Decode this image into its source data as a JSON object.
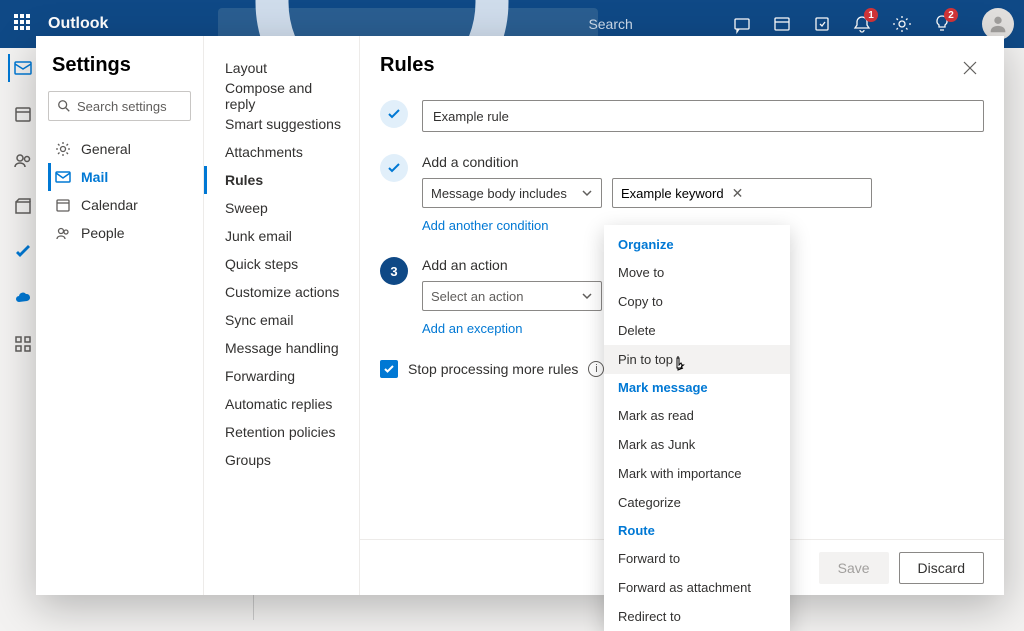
{
  "header": {
    "brand": "Outlook",
    "search_placeholder": "Search",
    "badges": {
      "bell": "1",
      "lightbulb": "2"
    }
  },
  "settings": {
    "title": "Settings",
    "search_placeholder": "Search settings",
    "categories": [
      {
        "key": "general",
        "label": "General",
        "icon": "gear"
      },
      {
        "key": "mail",
        "label": "Mail",
        "icon": "mail"
      },
      {
        "key": "calendar",
        "label": "Calendar",
        "icon": "calendar"
      },
      {
        "key": "people",
        "label": "People",
        "icon": "people"
      }
    ],
    "active_category": "mail",
    "subnav": [
      "Layout",
      "Compose and reply",
      "Smart suggestions",
      "Attachments",
      "Rules",
      "Sweep",
      "Junk email",
      "Quick steps",
      "Customize actions",
      "Sync email",
      "Message handling",
      "Forwarding",
      "Automatic replies",
      "Retention policies",
      "Groups"
    ],
    "active_sub": "Rules"
  },
  "rules": {
    "title": "Rules",
    "name_value": "Example rule",
    "step2_title": "Add a condition",
    "condition_dropdown": "Message body includes",
    "condition_value": "Example keyword",
    "add_condition": "Add another condition",
    "step3_title": "Add an action",
    "action_placeholder": "Select an action",
    "add_exception": "Add an exception",
    "stop_processing": "Stop processing more rules",
    "save": "Save",
    "discard": "Discard"
  },
  "action_menu": {
    "groups": [
      {
        "header": "Organize",
        "items": [
          "Move to",
          "Copy to",
          "Delete",
          "Pin to top"
        ]
      },
      {
        "header": "Mark message",
        "items": [
          "Mark as read",
          "Mark as Junk",
          "Mark with importance",
          "Categorize"
        ]
      },
      {
        "header": "Route",
        "items": [
          "Forward to",
          "Forward as attachment",
          "Redirect to"
        ]
      }
    ],
    "hovered": "Pin to top"
  }
}
